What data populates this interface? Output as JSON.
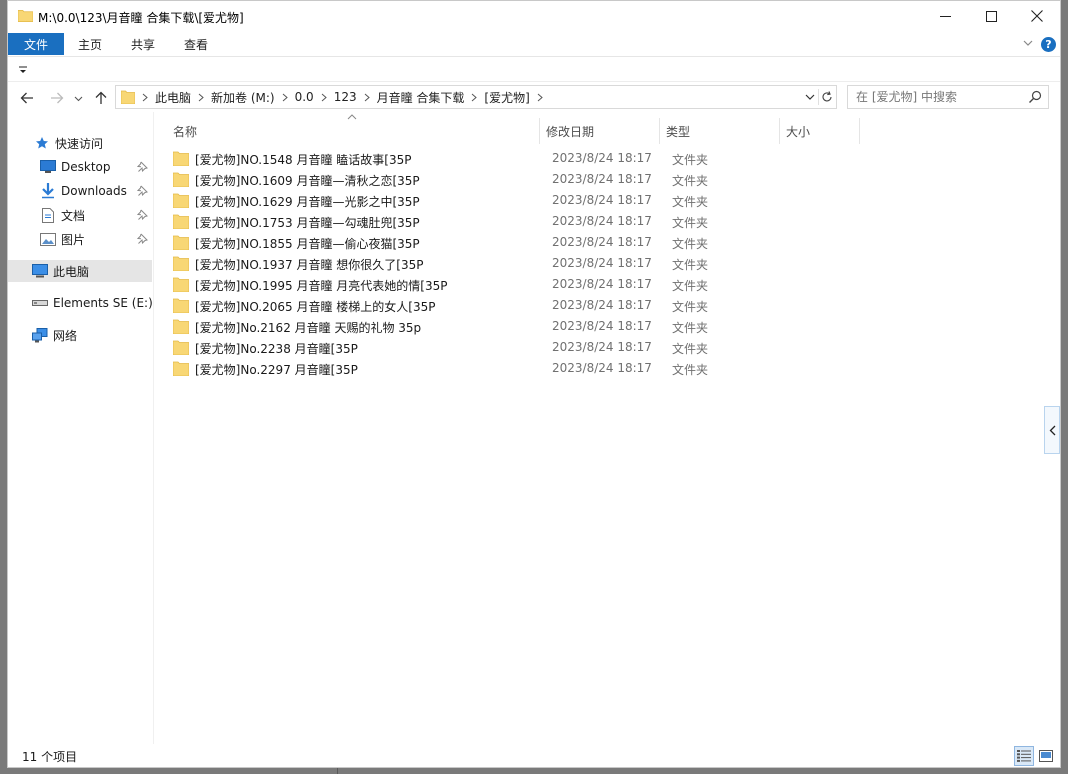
{
  "window": {
    "title": "M:\\0.0\\123\\月音瞳 合集下载\\[爱尤物]",
    "minimize_glyph": "─",
    "maximize_glyph": "☐",
    "close_glyph": "✕"
  },
  "ribbon": {
    "tabs": [
      "文件",
      "主页",
      "共享",
      "查看"
    ],
    "help_glyph": "?"
  },
  "address": {
    "crumbs": [
      "此电脑",
      "新加卷 (M:)",
      "0.0",
      "123",
      "月音瞳 合集下载",
      "[爱尤物]"
    ]
  },
  "search": {
    "placeholder": "在 [爱尤物] 中搜索"
  },
  "sidebar": {
    "quick_access": "快速访问",
    "items": [
      {
        "label": "Desktop",
        "icon": "desktop-icon",
        "pinned": true
      },
      {
        "label": "Downloads",
        "icon": "downloads-icon",
        "pinned": true
      },
      {
        "label": "文档",
        "icon": "documents-icon",
        "pinned": true
      },
      {
        "label": "图片",
        "icon": "pictures-icon",
        "pinned": true
      }
    ],
    "this_pc": "此电脑",
    "drive": "Elements SE (E:)",
    "network": "网络"
  },
  "columns": {
    "name": "名称",
    "date": "修改日期",
    "type": "类型",
    "size": "大小"
  },
  "files": [
    {
      "name": "[爱尤物]NO.1548 月音瞳 瞌话故事[35P",
      "date": "2023/8/24 18:17",
      "type": "文件夹"
    },
    {
      "name": "[爱尤物]NO.1609 月音瞳—清秋之恋[35P",
      "date": "2023/8/24 18:17",
      "type": "文件夹"
    },
    {
      "name": "[爱尤物]NO.1629 月音瞳—光影之中[35P",
      "date": "2023/8/24 18:17",
      "type": "文件夹"
    },
    {
      "name": "[爱尤物]NO.1753 月音瞳—勾魂肚兜[35P",
      "date": "2023/8/24 18:17",
      "type": "文件夹"
    },
    {
      "name": "[爱尤物]NO.1855 月音瞳—偷心夜猫[35P",
      "date": "2023/8/24 18:17",
      "type": "文件夹"
    },
    {
      "name": "[爱尤物]NO.1937 月音瞳 想你很久了[35P",
      "date": "2023/8/24 18:17",
      "type": "文件夹"
    },
    {
      "name": "[爱尤物]NO.1995 月音瞳 月亮代表她的情[35P",
      "date": "2023/8/24 18:17",
      "type": "文件夹"
    },
    {
      "name": "[爱尤物]NO.2065 月音瞳 楼梯上的女人[35P",
      "date": "2023/8/24 18:17",
      "type": "文件夹"
    },
    {
      "name": "[爱尤物]No.2162 月音瞳 天赐的礼物 35p",
      "date": "2023/8/24 18:17",
      "type": "文件夹"
    },
    {
      "name": "[爱尤物]No.2238 月音瞳[35P",
      "date": "2023/8/24 18:17",
      "type": "文件夹"
    },
    {
      "name": "[爱尤物]No.2297 月音瞳[35P",
      "date": "2023/8/24 18:17",
      "type": "文件夹"
    }
  ],
  "status": {
    "item_count": "11 个项目"
  },
  "colors": {
    "accent": "#1a6fc0",
    "folder": "#f8d775",
    "folder_dark": "#e3b946",
    "selection": "#e5e5e5"
  }
}
